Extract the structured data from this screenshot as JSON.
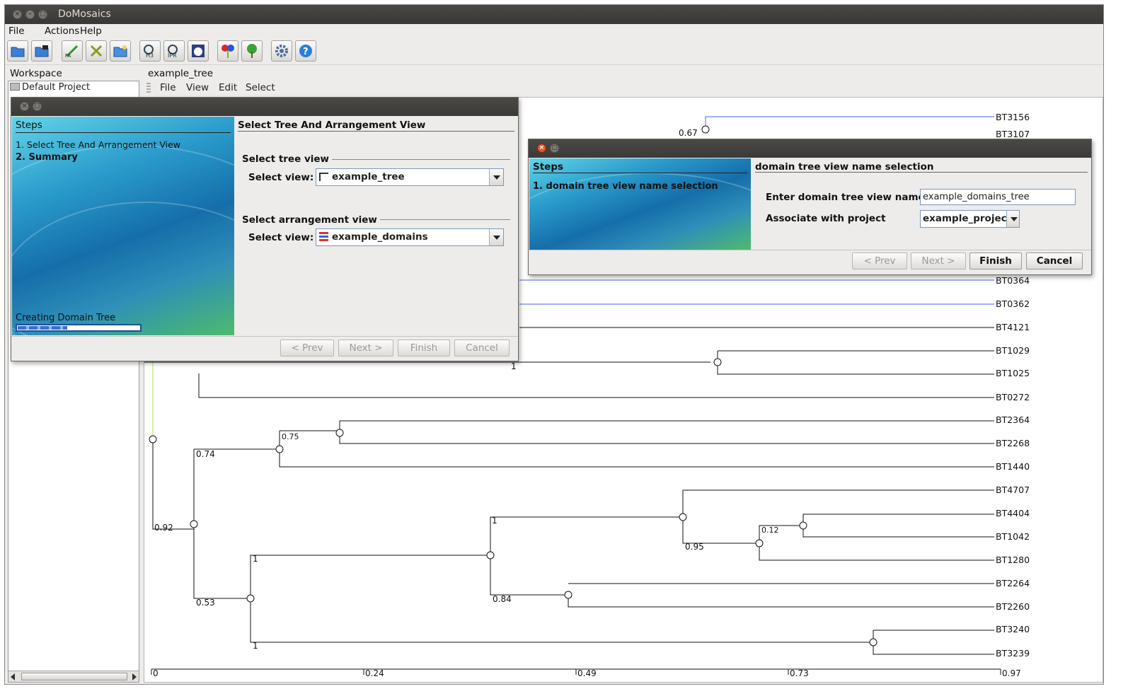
{
  "window": {
    "title": "DoMosaics"
  },
  "menu": [
    "File",
    "Actions",
    "Help"
  ],
  "toolbar": {
    "icons": [
      "open-folder-icon",
      "save-icon",
      "import-fasta-icon",
      "export-icon",
      "new-folder-icon",
      "hmmer3-scan-icon",
      "iprscan-icon",
      "bear-icon",
      "domain-tree-icon",
      "tree-icon",
      "settings-icon",
      "help-icon"
    ]
  },
  "workspace": {
    "title": "Workspace",
    "project": "Default Project"
  },
  "view": {
    "title": "example_tree",
    "menu": [
      "File",
      "View",
      "Edit",
      "Select"
    ]
  },
  "wizard1": {
    "steps_title": "Steps",
    "steps": [
      "1. Select Tree And Arrangement View",
      "2. Summary"
    ],
    "progress_label": "Creating Domain Tree",
    "heading": "Select Tree And Arrangement View",
    "tree_section": "Select tree view",
    "tree_label": "Select view:",
    "tree_value": "example_tree",
    "arr_section": "Select arrangement view",
    "arr_label": "Select view:",
    "arr_value": "example_domains",
    "buttons": {
      "prev": "< Prev",
      "next": "Next >",
      "finish": "Finish",
      "cancel": "Cancel"
    }
  },
  "wizard2": {
    "steps_title": "Steps",
    "steps": [
      "1. domain tree view name selection"
    ],
    "heading": "domain tree view name selection",
    "name_label": "Enter domain tree view name",
    "name_value": "example_domains_tree",
    "project_label": "Associate with project",
    "project_value": "example_project",
    "buttons": {
      "prev": "< Prev",
      "next": "Next >",
      "finish": "Finish",
      "cancel": "Cancel"
    }
  },
  "tree": {
    "leaves": [
      "BT3156",
      "BT3107",
      "BT0364",
      "BT0362",
      "BT4121",
      "BT1029",
      "BT1025",
      "BT0272",
      "BT2364",
      "BT2268",
      "BT1440",
      "BT4707",
      "BT4404",
      "BT1042",
      "BT1280",
      "BT2264",
      "BT2260",
      "BT3240",
      "BT3239"
    ],
    "support_values": [
      "0.67",
      "1",
      "0.75",
      "0.74",
      "0.92",
      "1",
      "0.95",
      "0.12",
      "1",
      "0.84",
      "0.53",
      "1"
    ],
    "axis_ticks": [
      "0",
      "0.24",
      "0.49",
      "0.73",
      "0.97"
    ]
  },
  "colors": {
    "titlebar": "#3c3b37",
    "wizard_accent": "#1f7fb8",
    "branch_blue": "#4a5ee8"
  }
}
